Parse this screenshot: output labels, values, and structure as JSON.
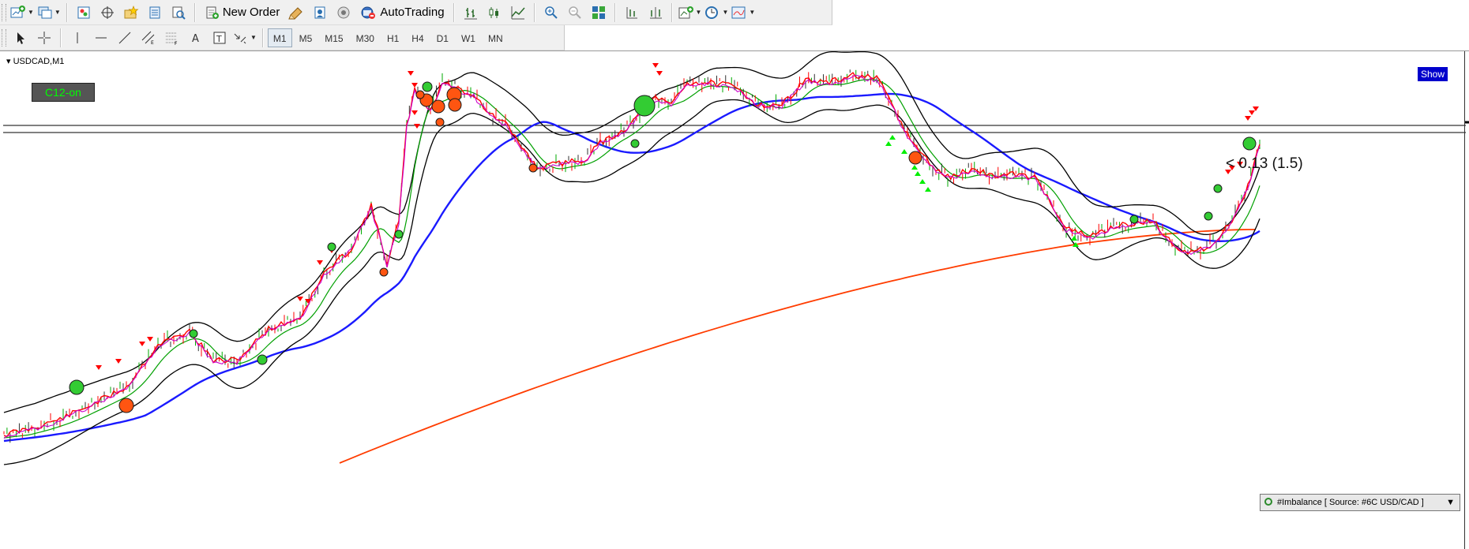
{
  "toolbar_main": {
    "new_order_label": "New Order",
    "autotrading_label": "AutoTrading",
    "icons": [
      "new-chart-icon",
      "profiles-icon",
      "market-watch-icon",
      "navigator-icon",
      "favorites-icon",
      "data-window-icon",
      "terminal-icon",
      "strategy-tester-icon",
      "new-order-icon",
      "metaeditor-icon",
      "signals-icon",
      "market-icon",
      "autotrading-icon",
      "bar-chart-icon",
      "candlesticks-icon",
      "line-chart-icon",
      "zoom-in-icon",
      "zoom-out-icon",
      "tile-windows-icon",
      "chart-shift-icon",
      "autoscroll-icon",
      "indicators-icon",
      "periods-icon",
      "templates-icon"
    ]
  },
  "toolbar_draw": {
    "icons": [
      "cursor-icon",
      "crosshair-icon",
      "vertical-line-icon",
      "horizontal-line-icon",
      "trendline-icon",
      "equidistant-channel-icon",
      "fibonacci-icon",
      "text-icon",
      "text-label-icon",
      "arrows-icon"
    ],
    "timeframes": [
      "M1",
      "M5",
      "M15",
      "M30",
      "H1",
      "H4",
      "D1",
      "W1",
      "MN"
    ],
    "active_timeframe": "M1"
  },
  "chart": {
    "symbol": "USDCAD,M1",
    "ea_button": "C12-on",
    "show_button": "Show",
    "price_label": "< 0.13 (1.5)",
    "imbalance_panel": "#Imbalance [ Source: #6C USD/CAD ]",
    "colors": {
      "bollinger": "#000000",
      "ma_slow": "#ff3c00",
      "ma_mid": "#1a1aff",
      "ma_fast_green": "#00a000",
      "ma_fast_red": "#ff0000",
      "ma_fast_magenta": "#cc00cc",
      "signal_up": "#00ee00",
      "signal_down": "#ff0000",
      "dot_green": "#33cc33",
      "dot_orange": "#ff5511"
    }
  }
}
